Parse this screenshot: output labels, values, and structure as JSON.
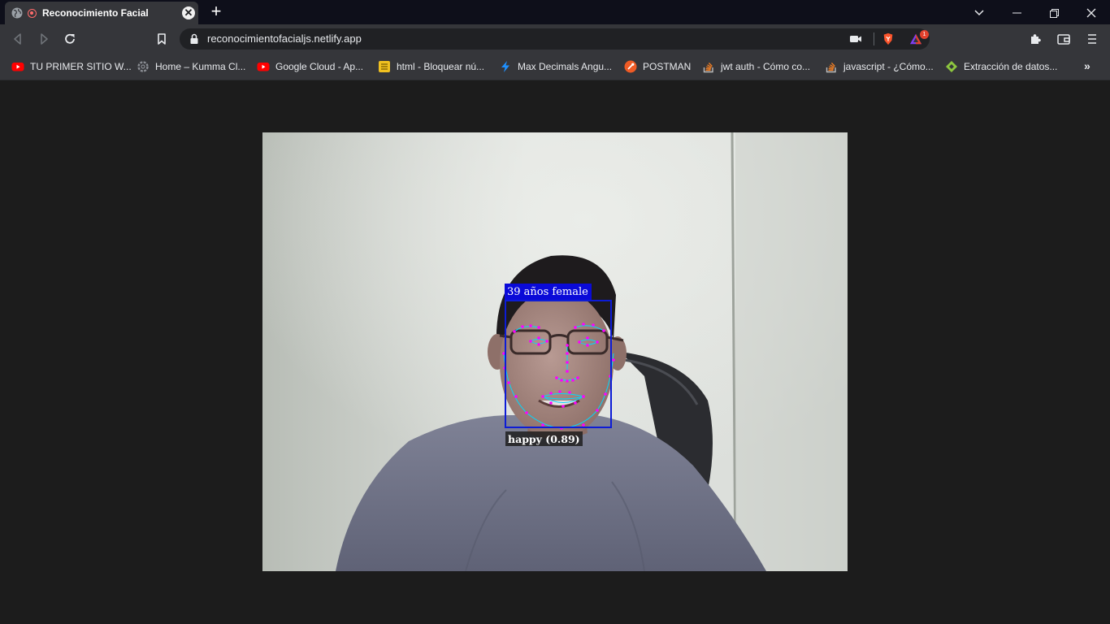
{
  "tab": {
    "title": "Reconocimiento Facial",
    "close": "✕",
    "new_tab": "+"
  },
  "window_controls": {
    "dropdown": "⌵",
    "minimize": "—",
    "restore": "❐",
    "close": "✕"
  },
  "toolbar": {
    "url": "reconocimientofacialjs.netlify.app",
    "notification_count": "1"
  },
  "bookmarks": [
    {
      "label": "TU PRIMER SITIO W...",
      "icon": "youtube-icon"
    },
    {
      "label": "Home – Kumma Cl...",
      "icon": "gear-icon"
    },
    {
      "label": "Google Cloud - Ap...",
      "icon": "youtube-icon"
    },
    {
      "label": "html - Bloquear nú...",
      "icon": "stackexchange-icon"
    },
    {
      "label": "Max Decimals Angu...",
      "icon": "bolt-icon"
    },
    {
      "label": "POSTMAN",
      "icon": "postman-icon"
    },
    {
      "label": "jwt auth - Cómo co...",
      "icon": "stackoverflow-icon"
    },
    {
      "label": "javascript - ¿Cómo...",
      "icon": "stackoverflow-icon"
    },
    {
      "label": "Extracción de datos...",
      "icon": "diamond-icon"
    }
  ],
  "bookmarks_more": "»",
  "detection": {
    "age_gender_label": "39 años female",
    "expression_label": "happy (0.89)"
  },
  "colors": {
    "detection_box": "#0d1cd6",
    "landmarks": "#ff00ff",
    "landmark_lines": "#00d8ff"
  }
}
